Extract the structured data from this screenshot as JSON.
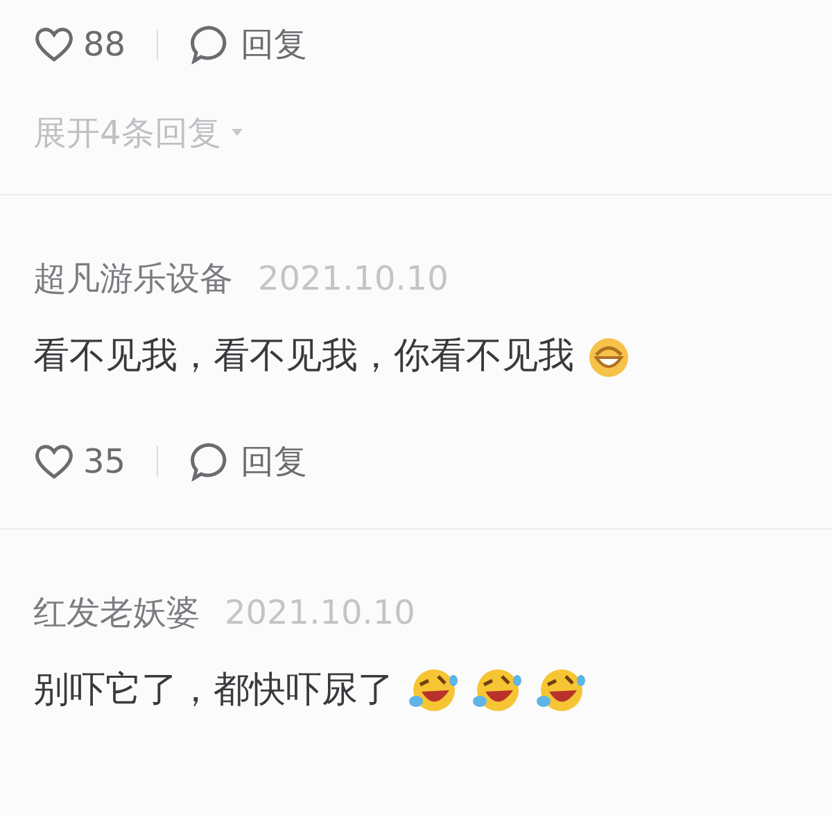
{
  "comments": [
    {
      "likes": "88",
      "reply_label": "回复",
      "expand_label": "展开4条回复"
    },
    {
      "author": "超凡游乐设备",
      "date": "2021.10.10",
      "body": [
        {
          "kind": "text",
          "text": "看不见我，看不见我，你看不见我"
        },
        {
          "kind": "grin"
        }
      ],
      "likes": "35",
      "reply_label": "回复"
    },
    {
      "author": "红发老妖婆",
      "date": "2021.10.10",
      "body": [
        {
          "kind": "text",
          "text": "别吓它了，都快吓尿了"
        },
        {
          "kind": "laugh-cry"
        },
        {
          "kind": "laugh-cry"
        },
        {
          "kind": "laugh-cry"
        }
      ]
    }
  ]
}
